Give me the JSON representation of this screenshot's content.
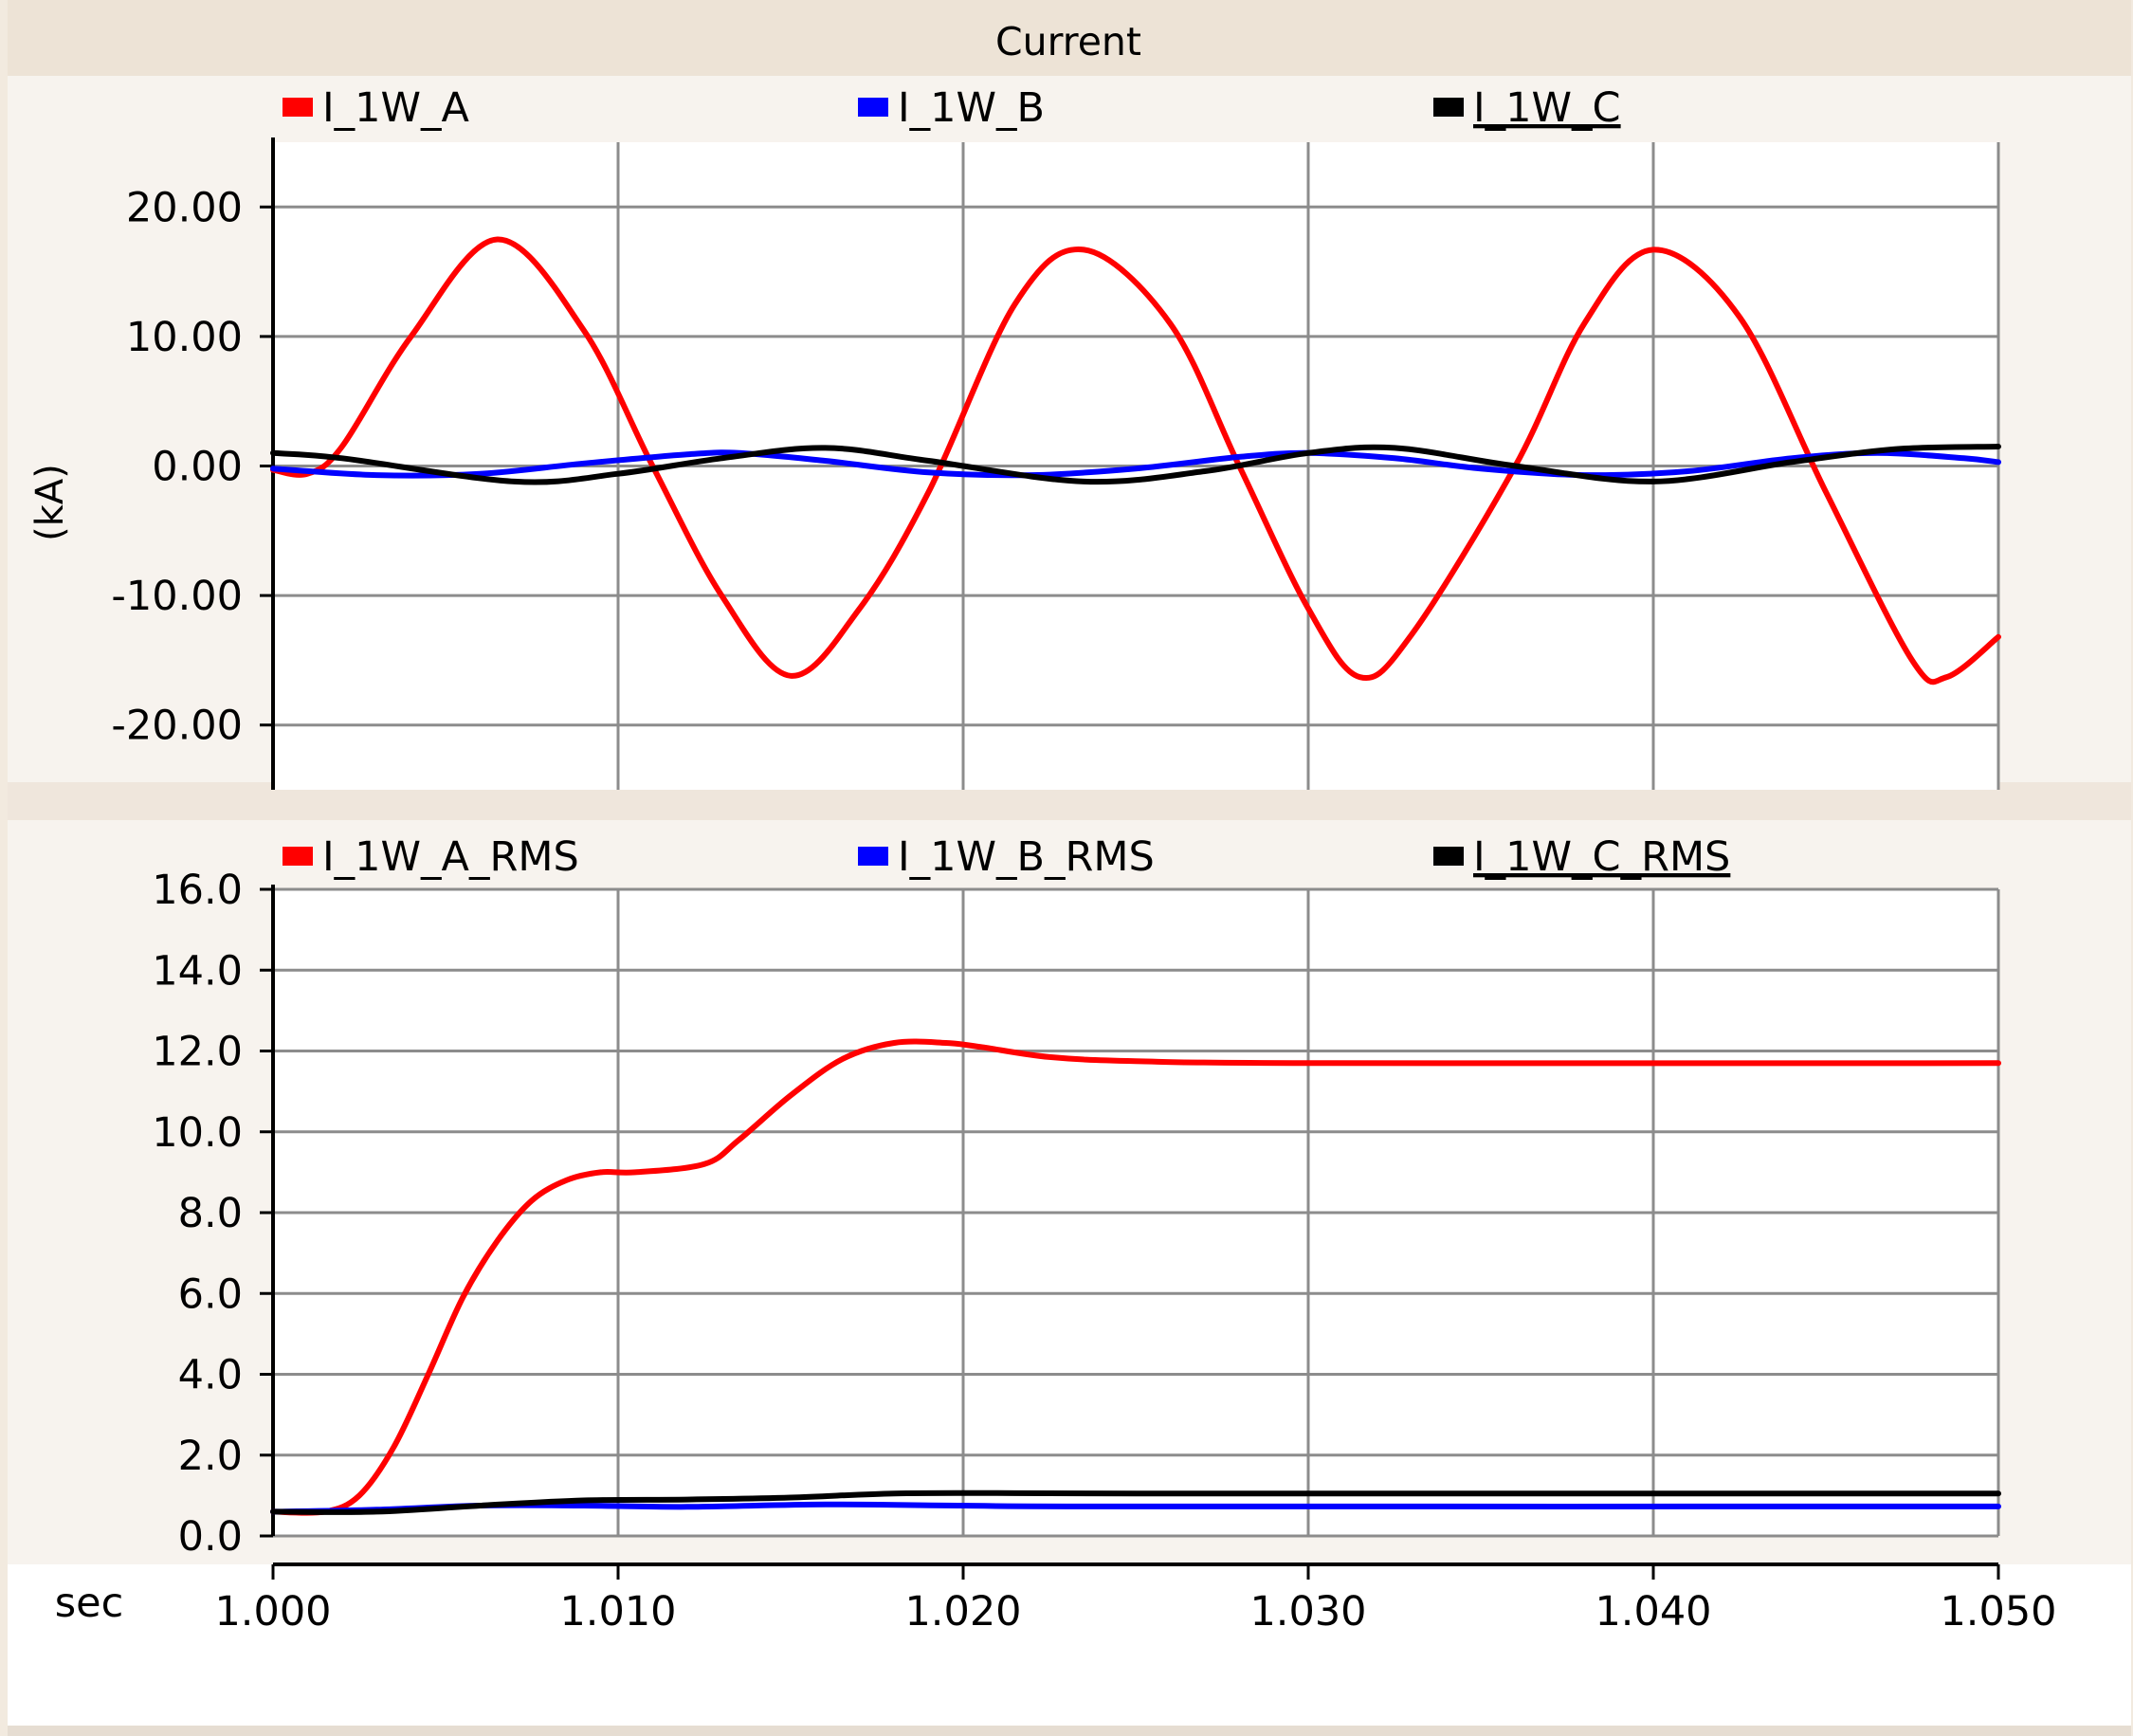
{
  "window": {
    "title": "Current"
  },
  "x_axis": {
    "unit_label": "sec",
    "ticks": [
      "1.000",
      "1.010",
      "1.020",
      "1.030",
      "1.040",
      "1.050"
    ],
    "range": [
      1.0,
      1.05
    ]
  },
  "chart_data": [
    {
      "type": "line",
      "ylabel": "(kA)",
      "ylim": [
        -25,
        25
      ],
      "xlim": [
        1.0,
        1.05
      ],
      "y_ticks": [
        "20.00",
        "10.00",
        "0.00",
        "-10.00",
        "-20.00"
      ],
      "y_tick_values": [
        20,
        10,
        0,
        -10,
        -20
      ],
      "grid": true,
      "legend_position": "top",
      "series": [
        {
          "name": "I_1W_A",
          "color": "#ff0000",
          "x": [
            1.0,
            1.001,
            1.002,
            1.004,
            1.0065,
            1.009,
            1.011,
            1.013,
            1.015,
            1.017,
            1.019,
            1.0215,
            1.0235,
            1.026,
            1.028,
            1.03,
            1.0315,
            1.033,
            1.036,
            1.038,
            1.04,
            1.0425,
            1.045,
            1.0475,
            1.0485,
            1.05
          ],
          "y": [
            -0.3,
            -0.6,
            1.5,
            10.0,
            17.5,
            10.5,
            0.0,
            -10.0,
            -16.2,
            -11.0,
            -2.0,
            12.5,
            16.7,
            11.0,
            0.0,
            -11.0,
            -16.3,
            -13.0,
            0.0,
            11.0,
            16.7,
            11.5,
            -2.0,
            -15.0,
            -16.3,
            -13.2
          ]
        },
        {
          "name": "I_1W_B",
          "color": "#0000ff",
          "x": [
            1.0,
            1.003,
            1.006,
            1.009,
            1.012,
            1.0135,
            1.016,
            1.019,
            1.022,
            1.025,
            1.028,
            1.03,
            1.0325,
            1.035,
            1.038,
            1.041,
            1.044,
            1.0465,
            1.049,
            1.05
          ],
          "y": [
            -0.2,
            -0.7,
            -0.6,
            0.2,
            0.9,
            1.0,
            0.4,
            -0.5,
            -0.7,
            -0.2,
            0.7,
            1.0,
            0.6,
            -0.2,
            -0.7,
            -0.4,
            0.6,
            1.0,
            0.6,
            0.3
          ]
        },
        {
          "name": "I_1W_C",
          "color": "#000000",
          "x": [
            1.0,
            1.002,
            1.007,
            1.01,
            1.013,
            1.016,
            1.019,
            1.0235,
            1.027,
            1.03,
            1.0325,
            1.036,
            1.04,
            1.044,
            1.047,
            1.05
          ],
          "y": [
            1.0,
            0.6,
            -1.2,
            -0.6,
            0.6,
            1.4,
            0.4,
            -1.2,
            -0.4,
            1.0,
            1.4,
            0.0,
            -1.2,
            0.3,
            1.3,
            1.5
          ]
        }
      ]
    },
    {
      "type": "line",
      "ylim": [
        0.0,
        16.0
      ],
      "xlim": [
        1.0,
        1.05
      ],
      "y_ticks": [
        "16.0",
        "14.0",
        "12.0",
        "10.0",
        "8.0",
        "6.0",
        "4.0",
        "2.0",
        "0.0"
      ],
      "y_tick_values": [
        16,
        14,
        12,
        10,
        8,
        6,
        4,
        2,
        0
      ],
      "grid": true,
      "legend_position": "top",
      "series": [
        {
          "name": "I_1W_A_RMS",
          "color": "#ff0000",
          "x": [
            1.0,
            1.0015,
            1.0025,
            1.0035,
            1.0045,
            1.0055,
            1.0065,
            1.0075,
            1.0085,
            1.0095,
            1.0105,
            1.0125,
            1.0135,
            1.015,
            1.0165,
            1.018,
            1.0195,
            1.0205,
            1.0225,
            1.025,
            1.03,
            1.05
          ],
          "y": [
            0.6,
            0.6,
            1.0,
            2.2,
            4.0,
            5.9,
            7.3,
            8.3,
            8.8,
            9.0,
            9.0,
            9.2,
            9.8,
            10.9,
            11.8,
            12.2,
            12.2,
            12.1,
            11.85,
            11.75,
            11.7,
            11.7
          ]
        },
        {
          "name": "I_1W_B_RMS",
          "color": "#0000ff",
          "x": [
            1.0,
            1.003,
            1.006,
            1.009,
            1.012,
            1.016,
            1.02,
            1.025,
            1.05
          ],
          "y": [
            0.6,
            0.65,
            0.75,
            0.75,
            0.72,
            0.78,
            0.75,
            0.73,
            0.73
          ]
        },
        {
          "name": "I_1W_C_RMS",
          "color": "#000000",
          "x": [
            1.0,
            1.003,
            1.006,
            1.009,
            1.012,
            1.015,
            1.018,
            1.021,
            1.025,
            1.05
          ],
          "y": [
            0.6,
            0.6,
            0.75,
            0.88,
            0.9,
            0.95,
            1.05,
            1.06,
            1.05,
            1.05
          ]
        }
      ]
    }
  ]
}
